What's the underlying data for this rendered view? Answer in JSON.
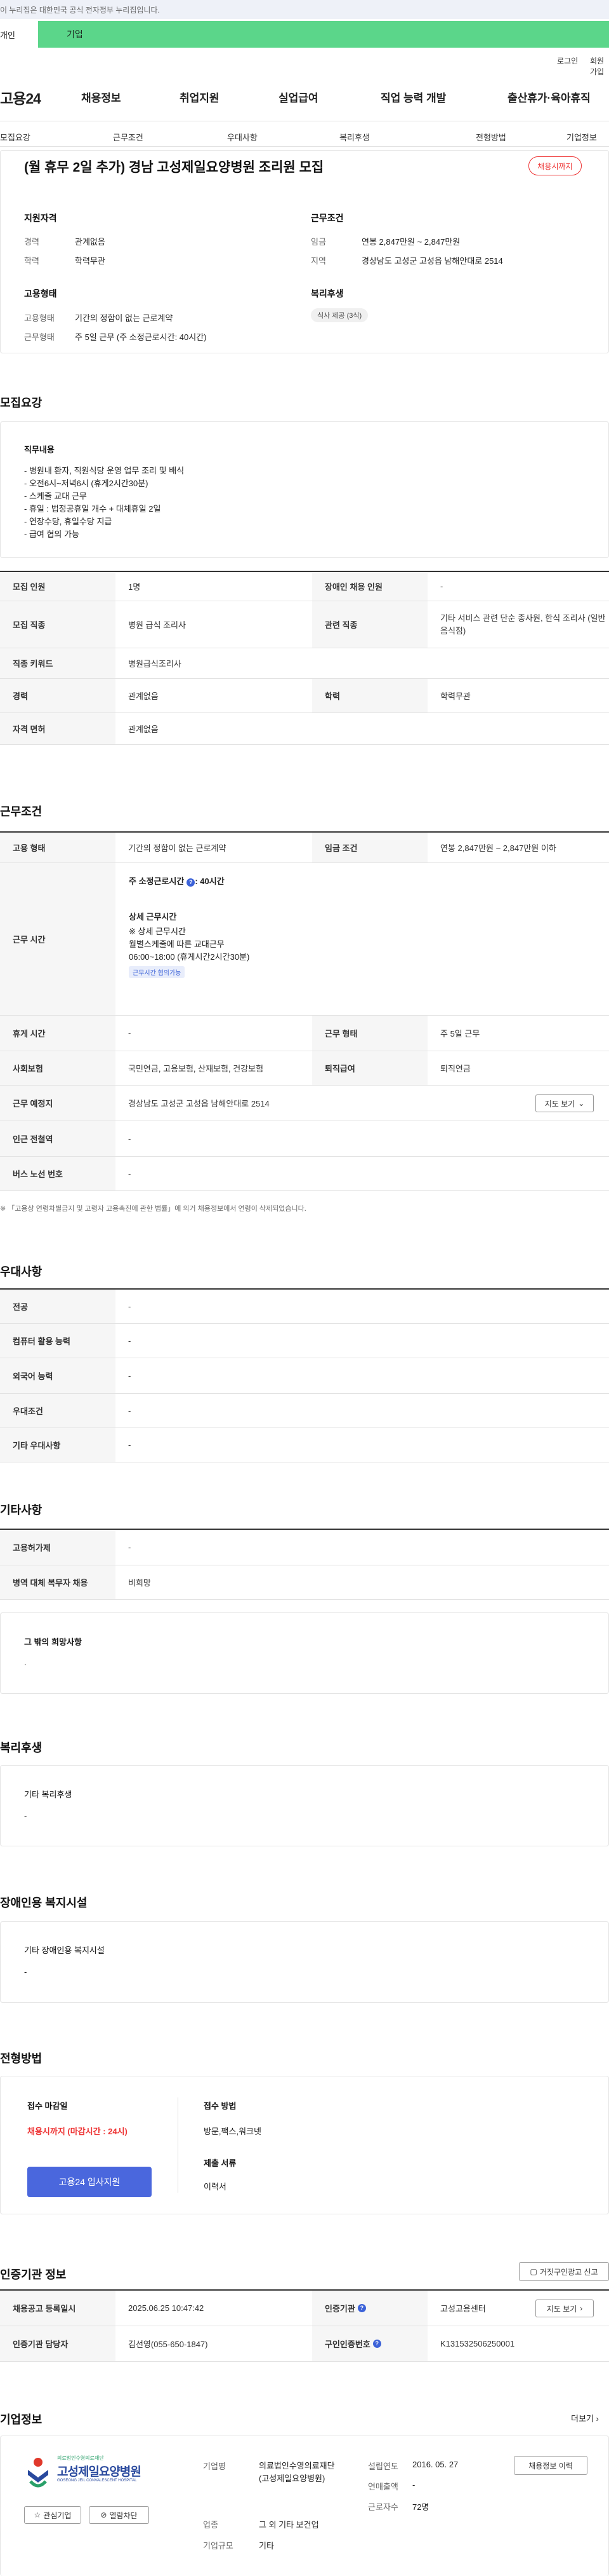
{
  "notice": "이 누리집은 대한민국 공식 전자정부 누리집입니다.",
  "toggle": {
    "individual": "개인",
    "corporate": "기업"
  },
  "util": {
    "login": "로그인",
    "join": "회원가입"
  },
  "logo": "고용24",
  "gnb": [
    "채용정보",
    "취업지원",
    "실업급여",
    "직업 능력 개발",
    "출산휴가·육아휴직"
  ],
  "tabs": [
    "모집요강",
    "근무조건",
    "우대사항",
    "복리후생",
    "전형방법",
    "기업정보"
  ],
  "job": {
    "title": "(월 휴무 2일 추가) 경남 고성제일요양병원 조리원 모집",
    "status": "채용시까지",
    "summary": {
      "qual_heading": "지원자격",
      "career_label": "경력",
      "career": "관계없음",
      "edu_label": "학력",
      "edu": "학력무관",
      "cond_heading": "근무조건",
      "wage_label": "임금",
      "wage": "연봉 2,847만원 ~ 2,847만원",
      "region_label": "지역",
      "region": "경상남도 고성군 고성읍 남해안대로 2514",
      "emp_heading": "고용형태",
      "emptype_label": "고용형태",
      "emptype": "기간의 정함이 없는 근로계약",
      "worktype_label": "근무형태",
      "worktype": "주 5일 근무 (주 소정근로시간: 40시간)",
      "welfare_heading": "복리후생",
      "welfare_chip": "식사 제공 (3식)"
    }
  },
  "recruit": {
    "section": "모집요강",
    "duty_heading": "직무내용",
    "duty_lines": [
      "- 병원내 환자, 직원식당 운영 업무 조리 및 배식",
      "- 오전6시~저녁6시 (휴게2시간30분)",
      "- 스케줄 교대 근무",
      "- 휴일 : 법정공휴일 개수 + 대체휴일 2일",
      "- 연장수당, 휴일수당 지급",
      "- 급여 협의 가능"
    ],
    "rows": [
      {
        "k1": "모집 인원",
        "v1": "1명",
        "k2": "장애인 채용 인원",
        "v2": "-"
      },
      {
        "k1": "모집 직종",
        "v1": "병원 급식 조리사",
        "k2": "관련 직종",
        "v2": "기타 서비스 관련 단순 종사원, 한식 조리사 (일반 음식점)"
      },
      {
        "k1": "직종 키워드",
        "v1": "병원급식조리사"
      },
      {
        "k1": "경력",
        "v1": "관계없음",
        "k2": "학력",
        "v2": "학력무관"
      },
      {
        "k1": "자격 면허",
        "v1": "관계없음"
      }
    ]
  },
  "work": {
    "section": "근무조건",
    "emptype_k": "고용 형태",
    "emptype_v": "기간의 정함이 없는 근로계약",
    "wage_k": "임금 조건",
    "wage_v": "연봉 2,847만원 ~ 2,847만원 이하",
    "hours_k": "근무 시간",
    "hours_main": "주 소정근로시간",
    "hours_value": ": 40시간",
    "detail_heading": "상세 근무시간",
    "detail_lines": [
      "※ 상세 근무시간",
      " 월별스케줄에 따른 교대근무",
      "06:00~18:00 (휴게시간2시간30분)"
    ],
    "negotiable": "근무시간 협의가능",
    "rest_k": "휴게 시간",
    "rest_v": "-",
    "form_k": "근무 형태",
    "form_v": "주 5일 근무",
    "ins_k": "사회보험",
    "ins_v": "국민연금, 고용보험, 산재보험, 건강보험",
    "retire_k": "퇴직급여",
    "retire_v": "퇴직연금",
    "place_k": "근무 예정지",
    "place_v": "경상남도 고성군 고성읍 남해안대로 2514",
    "map_btn": "지도 보기",
    "subway_k": "인근 전철역",
    "subway_v": "-",
    "bus_k": "버스 노선 번호",
    "bus_v": "-",
    "note": "「고용상 연령차별금지 및 고령자 고용촉진에 관한 법률」에 의거 채용정보에서 연령이 삭제되었습니다."
  },
  "pref": {
    "section": "우대사항",
    "rows": [
      [
        "전공",
        "-"
      ],
      [
        "컴퓨터 활용 능력",
        "-"
      ],
      [
        "외국어 능력",
        "-"
      ],
      [
        "우대조건",
        "-"
      ],
      [
        "기타 우대사항",
        "-"
      ]
    ]
  },
  "etc": {
    "section": "기타사항",
    "rows": [
      [
        "고용허가제",
        "-"
      ],
      [
        "병역 대체 복무자 채용",
        "비희망"
      ]
    ],
    "box_heading": "그 밖의 희망사항",
    "box_value": "."
  },
  "welfare": {
    "section": "복리후생",
    "heading": "기타 복리후생",
    "value": "-"
  },
  "disabled": {
    "section": "장애인용 복지시설",
    "heading": "기타 장애인용 복지시설",
    "value": "-"
  },
  "selection": {
    "section": "전형방법",
    "deadline_heading": "접수 마감일",
    "deadline": "채용시까지 (마감시간 : 24시)",
    "apply_btn": "고용24 입사지원",
    "method_heading": "접수 방법",
    "method": "방문,팩스,워크넷",
    "docs_heading": "제출 서류",
    "docs": "이력서"
  },
  "agency": {
    "section": "인증기관 정보",
    "report_btn": "거짓구인광고 신고",
    "reg_k": "채용공고 등록일시",
    "reg_v": "2025.06.25 10:47:42",
    "org_k": "인증기관",
    "org_v": "고성고용센터",
    "map_btn": "지도 보기",
    "mgr_k": "인증기관 담당자",
    "mgr_v": "김선영(055-650-1847)",
    "num_k": "구인인증번호",
    "num_v": "K131532506250001"
  },
  "company": {
    "section": "기업정보",
    "more": "더보기",
    "logo_sub": "의료법인수영의료재단",
    "logo_name": "고성제일요양병원",
    "logo_en": "GOSEONG JEIL CONVALESCENT HOSPITAL",
    "fav_btn": "관심기업",
    "block_btn": "열람차단",
    "name_k": "기업명",
    "name_v": "의료법인수영의료재단(고성제일요양병원)",
    "est_k": "설립연도",
    "est_v": "2016. 05. 27",
    "sales_k": "연매출액",
    "sales_v": "-",
    "emp_k": "근로자수",
    "emp_v": "72명",
    "ind_k": "업종",
    "ind_v": "그 외 기타 보건업",
    "size_k": "기업규모",
    "size_v": "기타",
    "history_btn": "채용정보 이력"
  },
  "colors": {
    "accent_green": "#5bd68a",
    "accent_blue": "#4a67dd",
    "alert_red": "#e33333"
  }
}
